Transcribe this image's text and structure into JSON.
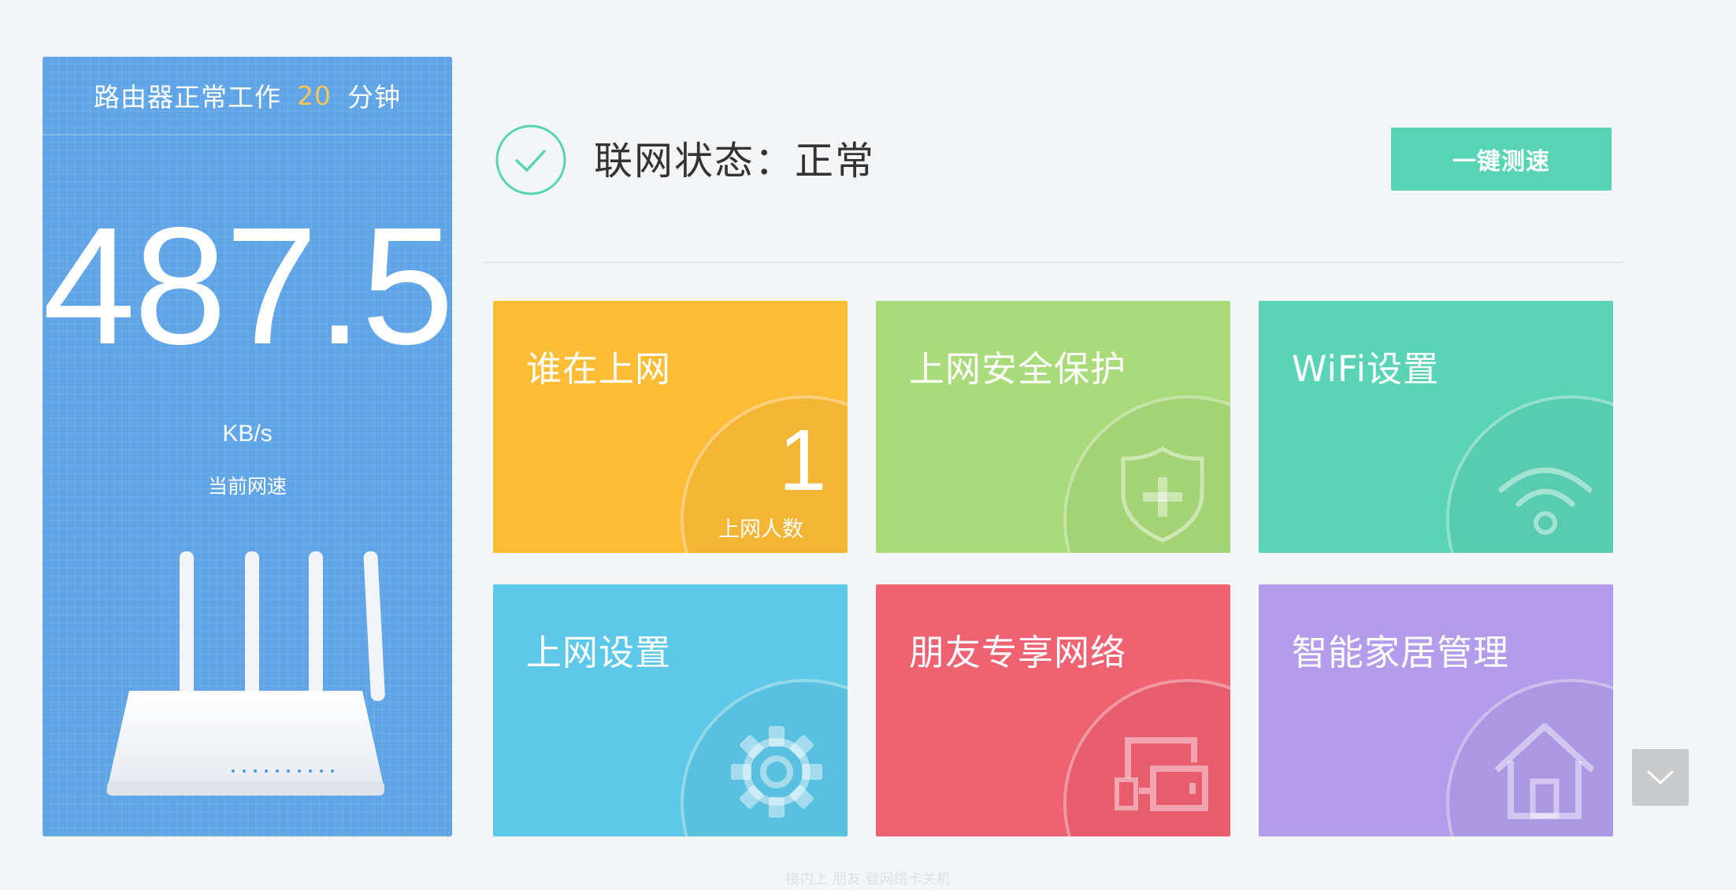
{
  "router_panel": {
    "uptime_prefix": "路由器正常工作",
    "uptime_value": "20",
    "uptime_unit": "分钟",
    "speed_value": "487.5",
    "speed_unit": "KB/s",
    "speed_label": "当前网速"
  },
  "status": {
    "text": "联网状态：正常",
    "speed_test_label": "一键测速"
  },
  "tiles": [
    {
      "title": "谁在上网",
      "color": "#fdbc36",
      "icon": "online-count",
      "count": "1",
      "count_label": "上网人数"
    },
    {
      "title": "上网安全保护",
      "color": "#aadb7a",
      "icon": "shield-plus-icon"
    },
    {
      "title": "WiFi设置",
      "color": "#5bd4b5",
      "icon": "wifi-icon"
    },
    {
      "title": "上网设置",
      "color": "#5dc8e8",
      "icon": "gear-icon"
    },
    {
      "title": "朋友专享网络",
      "color": "#ef6272",
      "icon": "devices-icon"
    },
    {
      "title": "智能家居管理",
      "color": "#b39deb",
      "icon": "house-icon"
    }
  ],
  "footer": {
    "text": "接内上 朋友 登网络卡关机"
  }
}
